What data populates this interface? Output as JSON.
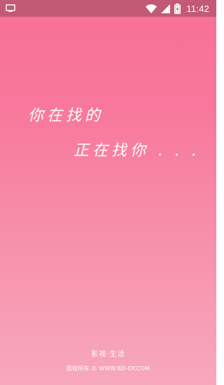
{
  "status_bar": {
    "time": "11:42",
    "icons": [
      "screen-icon",
      "wifi-icon",
      "signal-icon",
      "battery-charging-icon"
    ]
  },
  "splash": {
    "slogan_line_1": "你在找的",
    "slogan_line_2": "正在找你 . . .",
    "footer_title": "影视·生活",
    "footer_copyright": "版权所有 © WWW.BD-DY.COM"
  },
  "colors": {
    "background_top": "#f86f96",
    "background_bottom": "#f7a8bd",
    "status_bar": "#c25a76",
    "text": "#ffffff"
  }
}
